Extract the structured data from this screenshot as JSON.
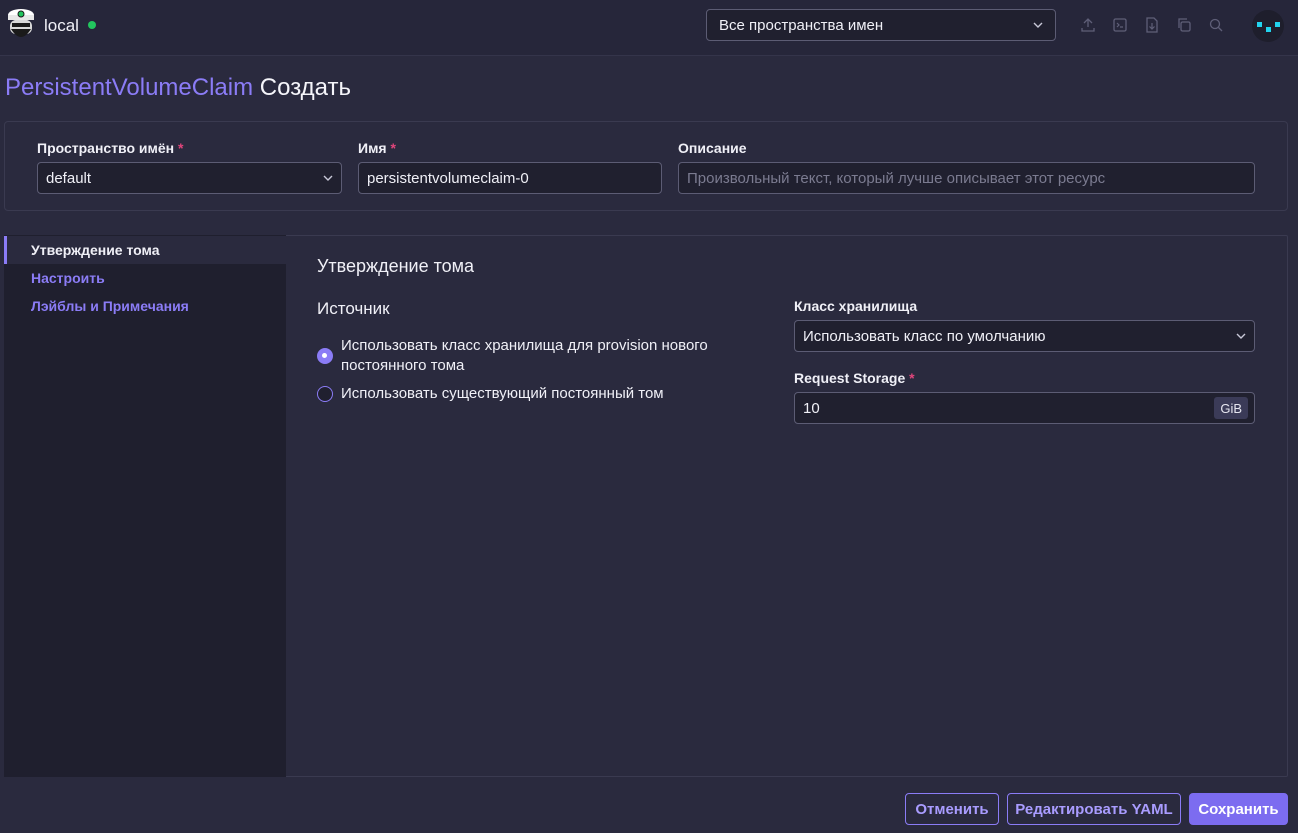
{
  "header": {
    "cluster_name": "local",
    "namespace_filter": "Все пространства имен",
    "icons": [
      "import-yaml-icon",
      "kubectl-shell-icon",
      "download-kubeconfig-icon",
      "copy-kubeconfig-icon",
      "search-icon"
    ]
  },
  "page": {
    "resource_type": "PersistentVolumeClaim",
    "action": "Создать"
  },
  "form": {
    "namespace_label": "Пространство имён",
    "namespace_value": "default",
    "name_label": "Имя",
    "name_value": "persistentvolumeclaim-0",
    "description_label": "Описание",
    "description_placeholder": "Произвольный текст, который лучше описывает этот ресурс",
    "required_mark": "*"
  },
  "sidebar": {
    "items": [
      {
        "label": "Утверждение тома",
        "active": true
      },
      {
        "label": "Настроить",
        "active": false
      },
      {
        "label": "Лэйблы и Примечания",
        "active": false
      }
    ]
  },
  "volume_claim": {
    "section_title": "Утверждение тома",
    "source_title": "Источник",
    "source_options": [
      {
        "label": "Использовать класс хранилища для provision нового постоянного тома",
        "checked": true
      },
      {
        "label": "Использовать существующий постоянный том",
        "checked": false
      }
    ],
    "storage_class_label": "Класс хранилища",
    "storage_class_value": "Использовать класс по умолчанию",
    "request_storage_label": "Request Storage",
    "request_storage_value": "10",
    "request_storage_unit": "GiB"
  },
  "footer": {
    "cancel_label": "Отменить",
    "edit_yaml_label": "Редактировать YAML",
    "save_label": "Сохранить"
  },
  "colors": {
    "accent": "#8b7cf6",
    "status_online": "#22c55e",
    "required": "#e0457b"
  }
}
